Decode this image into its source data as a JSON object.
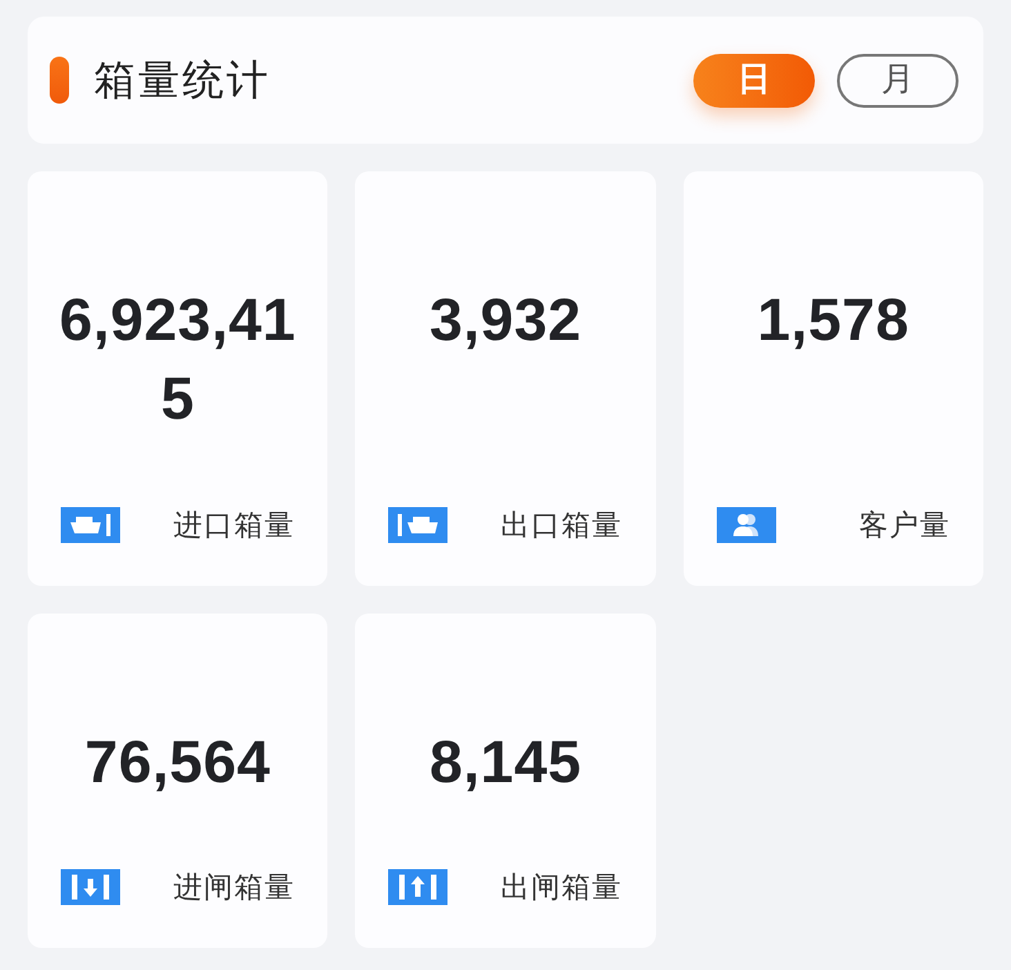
{
  "header": {
    "title": "箱量统计"
  },
  "toggles": [
    {
      "label": "日",
      "selected": true
    },
    {
      "label": "月",
      "selected": false
    }
  ],
  "stats": [
    {
      "value": "6,923,415",
      "label": "进口箱量",
      "kind": "import"
    },
    {
      "value": "3,932",
      "label": "出口箱量",
      "kind": "export"
    },
    {
      "value": "1,578",
      "label": "客户量",
      "kind": "customers"
    },
    {
      "value": "76,564",
      "label": "进闸箱量",
      "kind": "gate_in"
    },
    {
      "value": "8,145",
      "label": "出闸箱量",
      "kind": "gate_out"
    }
  ]
}
